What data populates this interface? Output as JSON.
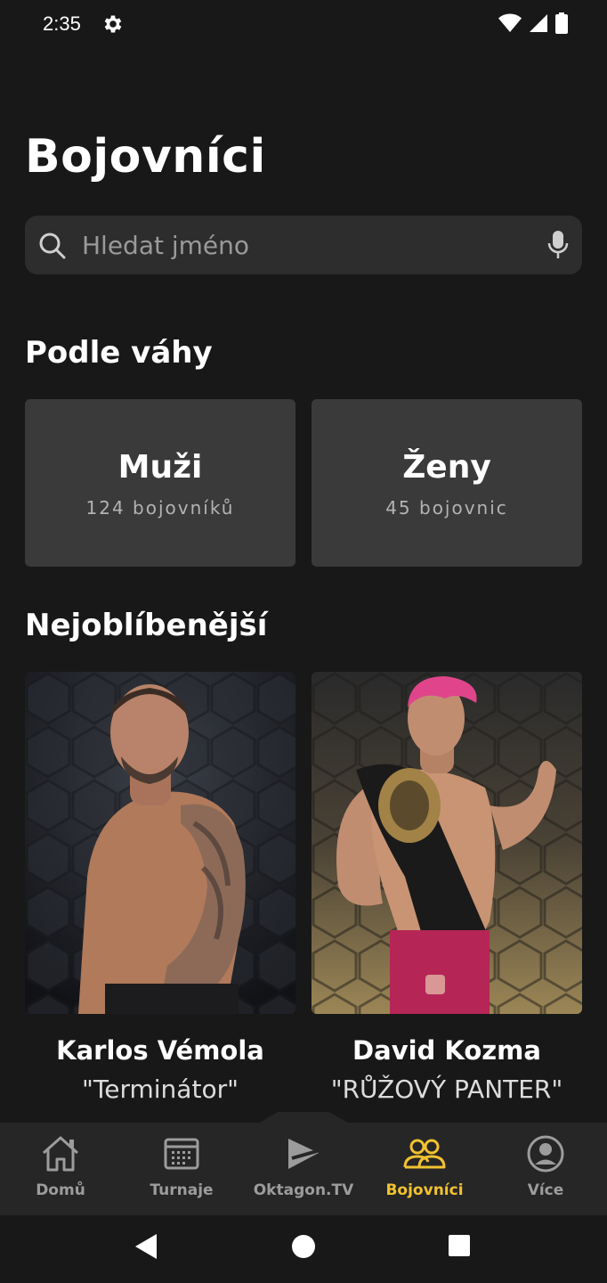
{
  "status_bar": {
    "time": "2:35"
  },
  "page": {
    "title": "Bojovníci"
  },
  "search": {
    "placeholder": "Hledat jméno"
  },
  "sections": {
    "by_weight": "Podle váhy",
    "popular": "Nejoblíbenější"
  },
  "weight_categories": [
    {
      "title": "Muži",
      "count": "124 bojovníků"
    },
    {
      "title": "Ženy",
      "count": "45 bojovnic"
    }
  ],
  "fighters": [
    {
      "name": "Karlos Vémola",
      "nickname": "\"Terminátor\""
    },
    {
      "name": "David Kozma",
      "nickname": "\"RŮŽOVÝ PANTER\""
    }
  ],
  "bottom_nav": [
    {
      "label": "Domů",
      "icon": "home-icon"
    },
    {
      "label": "Turnaje",
      "icon": "calendar-icon"
    },
    {
      "label": "Oktagon.TV",
      "icon": "oktagon-tv-icon"
    },
    {
      "label": "Bojovníci",
      "icon": "people-icon",
      "active": true
    },
    {
      "label": "Více",
      "icon": "profile-icon"
    }
  ],
  "colors": {
    "accent": "#f2c230",
    "background": "#181818",
    "card": "#3a3a3a",
    "nav": "#262626"
  }
}
